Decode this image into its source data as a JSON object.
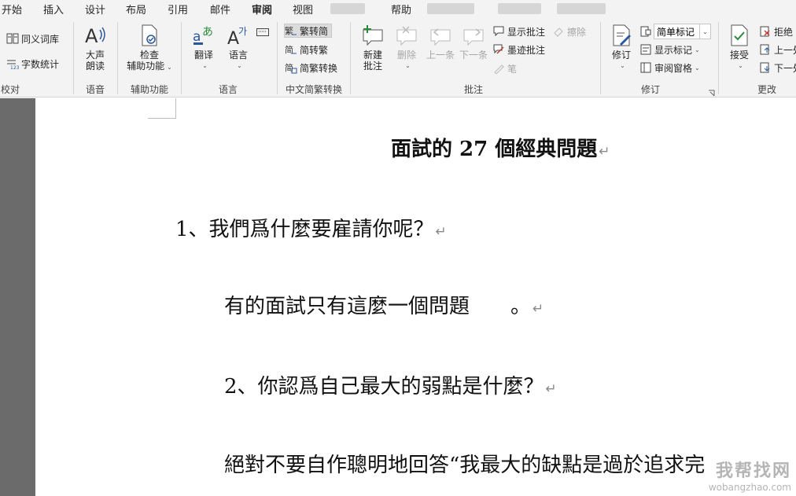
{
  "tabs": [
    {
      "label": "开始",
      "active": false
    },
    {
      "label": "插入",
      "active": false
    },
    {
      "label": "设计",
      "active": false
    },
    {
      "label": "布局",
      "active": false
    },
    {
      "label": "引用",
      "active": false
    },
    {
      "label": "邮件",
      "active": false
    },
    {
      "label": "审阅",
      "active": true
    },
    {
      "label": "视图",
      "active": false
    },
    {
      "label": "帮助",
      "active": false
    }
  ],
  "ribbon": {
    "proofing": {
      "thesaurus": "同义词库",
      "word_count": "字数统计",
      "group_label": "校对"
    },
    "speech": {
      "read_aloud_line1": "大声",
      "read_aloud_line2": "朗读",
      "group_label": "语音"
    },
    "accessibility": {
      "check_line1": "检查",
      "check_line2": "辅助功能",
      "group_label": "辅助功能"
    },
    "language": {
      "translate": "翻译",
      "language": "语言",
      "group_label": "语言"
    },
    "chinese_conversion": {
      "trad_to_simp": "繁转简",
      "simp_to_trad": "简转繁",
      "convert": "简繁转换",
      "group_label": "中文简繁转换"
    },
    "comments": {
      "new_line1": "新建",
      "new_line2": "批注",
      "delete": "删除",
      "previous": "上一条",
      "next": "下一条",
      "show_comments": "显示批注",
      "erase": "擦除",
      "ink_comment": "墨迹批注",
      "pen": "笔",
      "group_label": "批注"
    },
    "tracking": {
      "track_changes": "修订",
      "markup_mode": "简单标记",
      "show_markup": "显示标记",
      "reviewing_pane": "审阅窗格",
      "group_label": "修订"
    },
    "changes": {
      "accept": "接受",
      "reject": "拒绝",
      "previous": "上一处",
      "next": "下一处",
      "group_label": "更改"
    }
  },
  "document": {
    "title": "面試的 27 個經典問題",
    "paragraphs": [
      "1、我們爲什麼要雇請你呢？",
      "有的面試只有這麼一個問題　　。",
      "2、你認爲自己最大的弱點是什麼？",
      "絕對不要自作聰明地回答“我最大的缺點是過於追求完"
    ],
    "pilcrow": "↵"
  },
  "watermark": {
    "line1": "我帮找网",
    "line2": "wobangzhao.com"
  },
  "colors": {
    "accent": "#2b579a",
    "ribbon_bg": "#f3f3f3",
    "gutter": "#6b6b6b"
  }
}
